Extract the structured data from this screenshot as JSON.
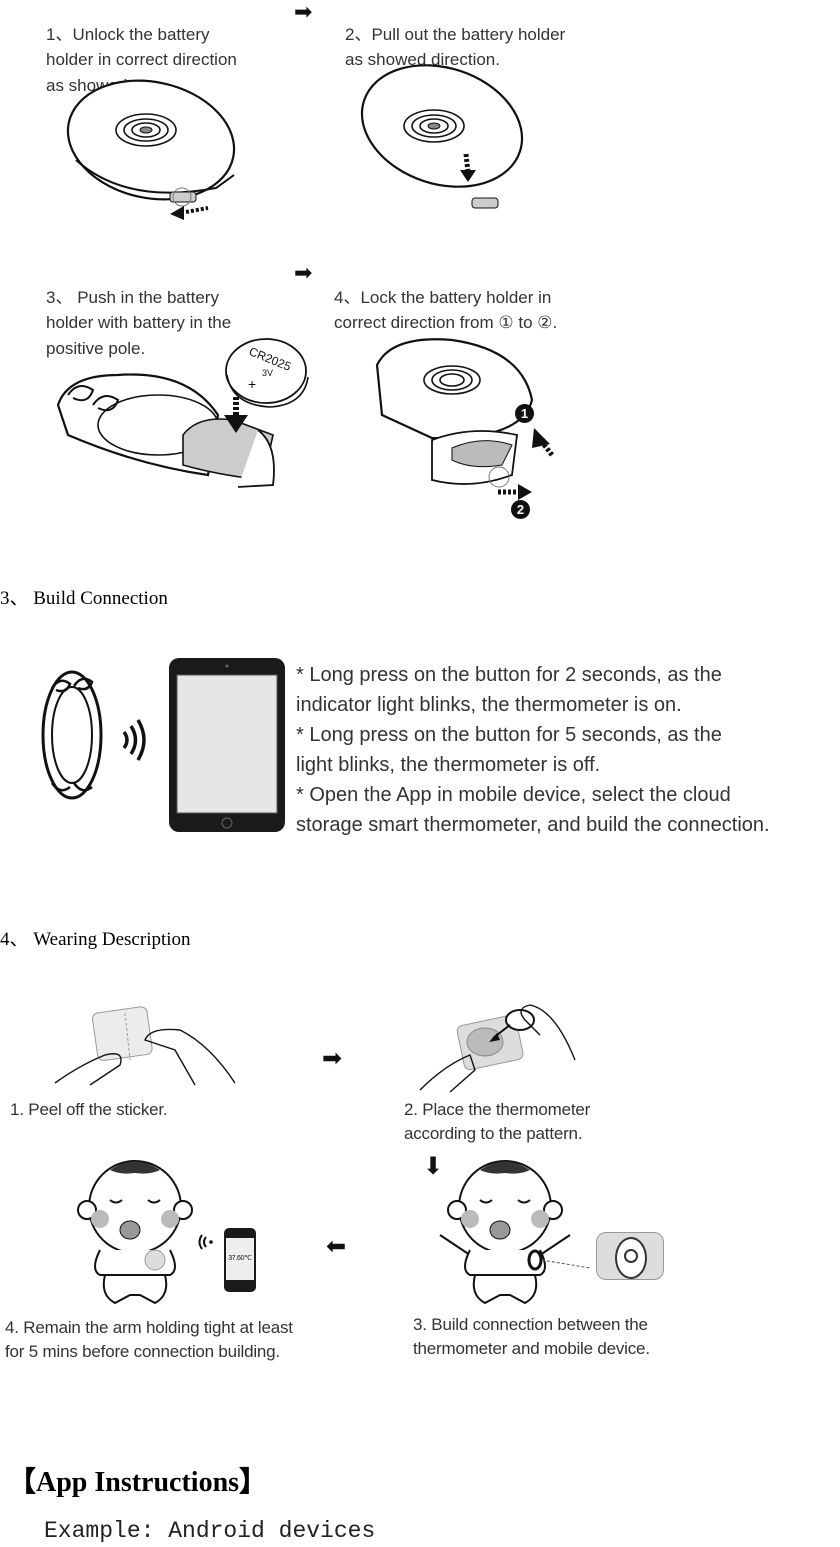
{
  "battery_steps": [
    {
      "number": "1、",
      "text": "Unlock the battery\nholder in correct direction\nas showed."
    },
    {
      "number": "2、",
      "text": "Pull out the battery holder\nas showed direction."
    },
    {
      "number": "3、",
      "text": " Push in the battery\nholder with battery in the\npositive pole."
    },
    {
      "number": "4、",
      "text": "Lock the battery holder in\n correct direction from ① to ②."
    }
  ],
  "battery_label": {
    "model": "CR2025",
    "voltage": "3V",
    "polarity": "+"
  },
  "lock_markers": [
    "1",
    "2"
  ],
  "section3": {
    "heading": "3、 Build Connection",
    "bullets": [
      "* Long press on the button for 2 seconds, as the\n indicator light blinks, the thermometer is on.",
      "* Long press on the button for 5 seconds, as the\n light blinks, the thermometer is off.",
      "* Open the App in mobile device, select the cloud\n storage smart thermometer, and build the connection."
    ]
  },
  "section4": {
    "heading": "4、 Wearing Description",
    "steps": [
      {
        "text": "1. Peel off the sticker."
      },
      {
        "text": "2. Place the thermometer\naccording to the pattern."
      },
      {
        "text": "3. Build connection between the\nthermometer and mobile device."
      },
      {
        "text": "4. Remain the arm holding tight at least\n    for 5 mins before connection building."
      }
    ],
    "phone_reading": "37.60℃"
  },
  "app_section": {
    "title": "【App Instructions】",
    "subtitle": "Example: Android devices"
  },
  "icons": {
    "arrow_right": "➡",
    "arrow_left": "⬅",
    "arrow_down": "⬇"
  }
}
